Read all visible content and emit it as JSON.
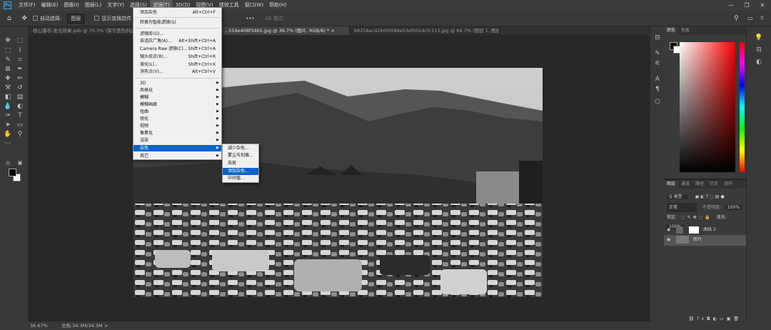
{
  "menubar": {
    "logo": "Ps",
    "items": [
      "文件(F)",
      "编辑(E)",
      "图像(I)",
      "图层(L)",
      "文字(Y)",
      "选择(S)",
      "滤镜(T)",
      "3D(D)",
      "视图(V)",
      "增效工具",
      "窗口(W)",
      "帮助(H)"
    ],
    "window_controls": [
      "—",
      "❐",
      "✕"
    ]
  },
  "options": {
    "auto_select": "自动选择:",
    "layer_select": "图层",
    "show_transform": "显示变换控件",
    "mode_3d": "3D 模式:",
    "more": "•••"
  },
  "tabs": [
    {
      "label": "桂山瀑布-发光效果.psb @ 76.3% (保守黑色斜边 ...",
      "active": false
    },
    {
      "label": "...516e408f34b5.jpg @ 36.7% (图片, RGB/8) *  ×",
      "active": true
    },
    {
      "label": "b8258ac42b0f0099e53ef0024cfc113.jpg @ 66.7% (图层 1, 图层蒙版/8) *  ×",
      "active": false
    }
  ],
  "filter_menu": {
    "top_items": [
      {
        "label": "添加杂色",
        "shortcut": "Alt+Ctrl+F"
      },
      {
        "label": "转换为智能滤镜(S)",
        "shortcut": ""
      }
    ],
    "mid_items": [
      {
        "label": "滤镜库(G)...",
        "shortcut": ""
      },
      {
        "label": "自适应广角(A)...",
        "shortcut": "Alt+Shift+Ctrl+A"
      },
      {
        "label": "Camera Raw 滤镜(C)...",
        "shortcut": "Shift+Ctrl+A"
      },
      {
        "label": "镜头校正(R)...",
        "shortcut": "Shift+Ctrl+R"
      },
      {
        "label": "液化(L)...",
        "shortcut": "Shift+Ctrl+X"
      },
      {
        "label": "消失点(V)...",
        "shortcut": "Alt+Ctrl+V"
      }
    ],
    "sub_items": [
      "3D",
      "风格化",
      "模糊",
      "模糊画廊",
      "扭曲",
      "锐化",
      "视频",
      "像素化",
      "渲染",
      "杂色",
      "其它"
    ],
    "highlighted": "杂色"
  },
  "noise_submenu": {
    "items": [
      "减少杂色...",
      "蒙尘与划痕...",
      "去斑",
      "添加杂色...",
      "中间值..."
    ],
    "highlighted": "添加杂色..."
  },
  "color_panel": {
    "tabs": [
      "颜色",
      "色板"
    ],
    "accent_hue": "#ff0000"
  },
  "layers_panel": {
    "tabs": [
      "图层",
      "通道",
      "路径",
      "历史",
      "动作"
    ],
    "kind_filter": "Q 类型",
    "blend_mode": "正常",
    "opacity_label": "不透明度:",
    "opacity_value": "100%",
    "lock_label": "锁定:",
    "fill_label": "填充:",
    "fill_value": "100%",
    "layers": [
      {
        "name": "曲线 2",
        "selected": false
      },
      {
        "name": "图片",
        "selected": true
      }
    ]
  },
  "statusbar": {
    "zoom": "36.67%",
    "doc": "文档:34.3M/34.3M",
    "arrow": ">"
  }
}
